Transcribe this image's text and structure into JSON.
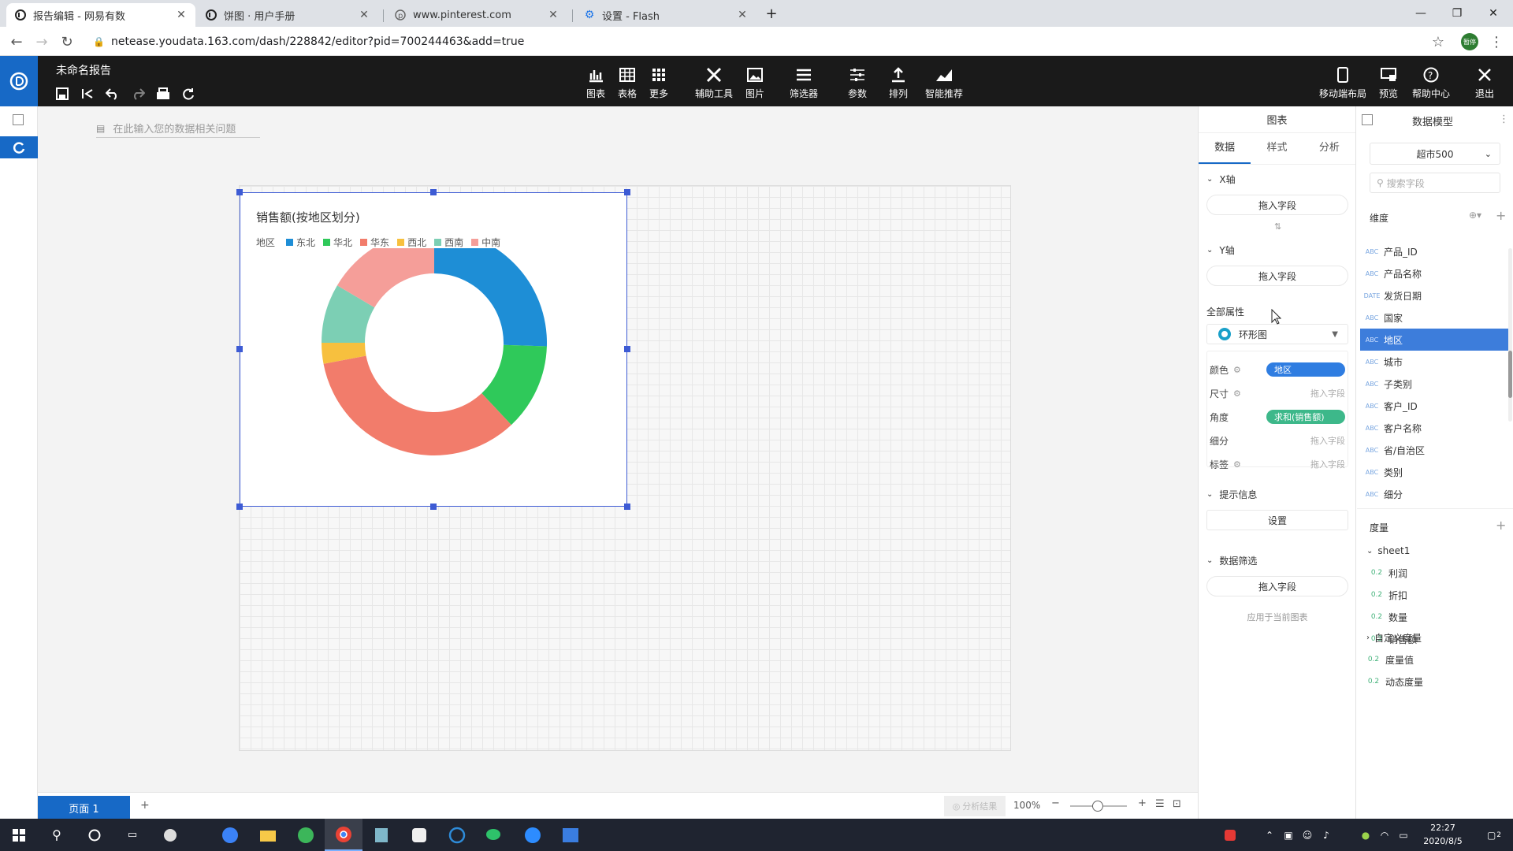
{
  "browser": {
    "tabs": [
      {
        "title": "报告编辑 - 网易有数",
        "active": true
      },
      {
        "title": "饼图 · 用户手册",
        "active": false
      },
      {
        "title": "www.pinterest.com",
        "active": false
      },
      {
        "title": "设置 - Flash",
        "active": false
      }
    ],
    "url": "netease.youdata.163.com/dash/228842/editor?pid=700244463&add=true",
    "profile_label": "暂停"
  },
  "app": {
    "report_title": "未命名报告",
    "toolbar": [
      {
        "label": "图表",
        "icon": "bar-chart-icon"
      },
      {
        "label": "表格",
        "icon": "table-icon"
      },
      {
        "label": "更多",
        "icon": "more-grid-icon"
      },
      {
        "label": "辅助工具",
        "icon": "tools-icon"
      },
      {
        "label": "图片",
        "icon": "image-icon"
      },
      {
        "label": "筛选器",
        "icon": "filter-icon"
      },
      {
        "label": "参数",
        "icon": "params-icon"
      },
      {
        "label": "排列",
        "icon": "arrange-icon"
      },
      {
        "label": "智能推荐",
        "icon": "smart-recommend-icon"
      }
    ],
    "right_tools": [
      {
        "label": "移动端布局",
        "icon": "mobile-icon"
      },
      {
        "label": "预览",
        "icon": "preview-icon"
      },
      {
        "label": "帮助中心",
        "icon": "help-icon"
      },
      {
        "label": "退出",
        "icon": "close-icon"
      }
    ]
  },
  "canvas": {
    "ask_placeholder": "在此输入您的数据相关问题",
    "page_tab": "页面 1",
    "add_page": "+",
    "analysis_result": "分析结果",
    "zoom": "100%"
  },
  "chart_data": {
    "type": "pie",
    "title": "销售额(按地区划分)",
    "legend_title": "地区",
    "donut": true,
    "series": [
      {
        "name": "东北",
        "value": 25.5,
        "color": "#1e8ed6"
      },
      {
        "name": "华北",
        "value": 12.5,
        "color": "#2fc95a"
      },
      {
        "name": "华东",
        "value": 34.0,
        "color": "#f27c6b"
      },
      {
        "name": "西北",
        "value": 3.0,
        "color": "#f7c03e"
      },
      {
        "name": "西南",
        "value": 8.5,
        "color": "#7ccfb4"
      },
      {
        "name": "中南",
        "value": 16.5,
        "color": "#f59e99"
      }
    ]
  },
  "chart_panel": {
    "title": "图表",
    "tabs": [
      "数据",
      "样式",
      "分析"
    ],
    "x_axis": "X轴",
    "y_axis": "Y轴",
    "drop_field": "拖入字段",
    "all_props": "全部属性",
    "chart_type": "环形图",
    "props": [
      {
        "label": "颜色",
        "value": "地区",
        "kind": "tag",
        "color": "#2f7de1"
      },
      {
        "label": "尺寸",
        "value": "拖入字段",
        "kind": "hint"
      },
      {
        "label": "角度",
        "value": "求和(销售额)",
        "kind": "tag",
        "color": "#3db88a"
      },
      {
        "label": "细分",
        "value": "拖入字段",
        "kind": "hint"
      },
      {
        "label": "标签",
        "value": "拖入字段",
        "kind": "hint"
      }
    ],
    "tooltip_section": "提示信息",
    "tooltip_button": "设置",
    "filter_section": "数据筛选",
    "apply_current": "应用于当前图表"
  },
  "data_model": {
    "title": "数据模型",
    "dataset": "超市500",
    "search_placeholder": "搜索字段",
    "dimensions_label": "维度",
    "dimensions": [
      {
        "name": "产品_ID",
        "type": "ABC"
      },
      {
        "name": "产品名称",
        "type": "ABC"
      },
      {
        "name": "发货日期",
        "type": "DATE"
      },
      {
        "name": "国家",
        "type": "ABC"
      },
      {
        "name": "地区",
        "type": "ABC",
        "selected": true
      },
      {
        "name": "城市",
        "type": "ABC"
      },
      {
        "name": "子类别",
        "type": "ABC"
      },
      {
        "name": "客户_ID",
        "type": "ABC"
      },
      {
        "name": "客户名称",
        "type": "ABC"
      },
      {
        "name": "省/自治区",
        "type": "ABC"
      },
      {
        "name": "类别",
        "type": "ABC"
      },
      {
        "name": "细分",
        "type": "ABC"
      }
    ],
    "measures_label": "度量",
    "sheet": "sheet1",
    "measures": [
      "利润",
      "折扣",
      "数量",
      "销售额"
    ],
    "custom_measure": "自定义度量",
    "extra_measures": [
      "度量值",
      "动态度量"
    ],
    "num_type": "0.2"
  },
  "taskbar": {
    "time": "22:27",
    "date": "2020/8/5",
    "notification_count": "2"
  }
}
